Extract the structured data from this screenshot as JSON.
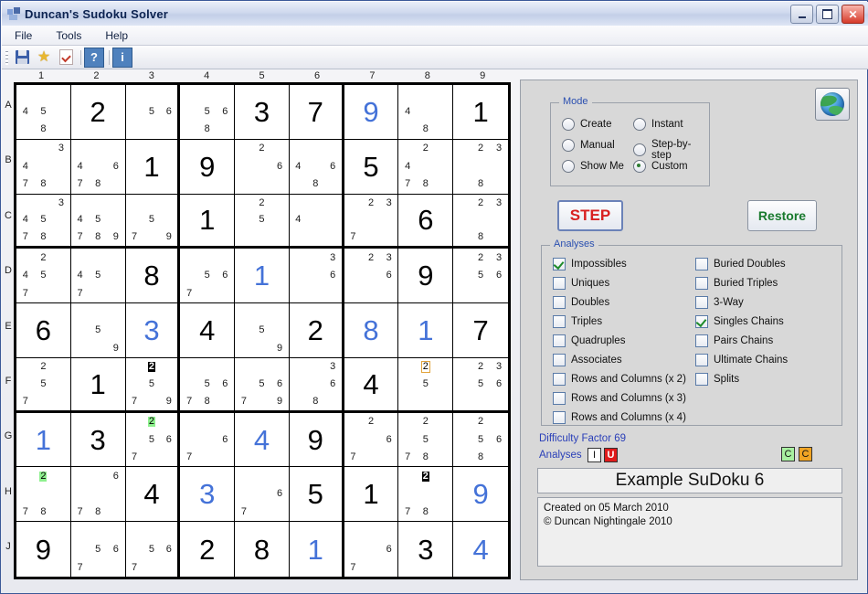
{
  "window": {
    "title": "Duncan's Sudoku Solver",
    "icon": "app-icon",
    "minimize_label": "Minimize",
    "maximize_label": "Maximize",
    "close_label": "✕"
  },
  "menu": {
    "items": [
      "File",
      "Tools",
      "Help"
    ]
  },
  "toolbar": {
    "items": [
      {
        "name": "save-icon",
        "label": ""
      },
      {
        "name": "star-icon",
        "label": ""
      },
      {
        "name": "check-document-icon",
        "label": ""
      },
      {
        "name": "help-button",
        "label": "?"
      },
      {
        "name": "info-button",
        "label": "i"
      }
    ]
  },
  "grid": {
    "column_labels": [
      "1",
      "2",
      "3",
      "4",
      "5",
      "6",
      "7",
      "8",
      "9"
    ],
    "row_labels": [
      "A",
      "B",
      "C",
      "D",
      "E",
      "F",
      "G",
      "H",
      "J"
    ],
    "cells": [
      [
        {
          "c": [
            null,
            null,
            null,
            "4",
            "5",
            null,
            null,
            "8",
            null
          ]
        },
        {
          "v": "2",
          "s": "given"
        },
        {
          "c": [
            null,
            null,
            null,
            null,
            "5",
            "6",
            null,
            null,
            null
          ]
        },
        {
          "c": [
            null,
            null,
            null,
            null,
            "5",
            "6",
            null,
            "8",
            null
          ]
        },
        {
          "v": "3",
          "s": "given"
        },
        {
          "v": "7",
          "s": "given"
        },
        {
          "v": "9",
          "s": "solved"
        },
        {
          "c": [
            null,
            null,
            null,
            "4",
            null,
            null,
            null,
            "8",
            null
          ]
        },
        {
          "v": "1",
          "s": "given"
        }
      ],
      [
        {
          "c": [
            null,
            null,
            "3",
            "4",
            null,
            null,
            "7",
            "8",
            null
          ]
        },
        {
          "c": [
            null,
            null,
            null,
            "4",
            null,
            "6",
            "7",
            "8",
            null
          ]
        },
        {
          "v": "1",
          "s": "given"
        },
        {
          "v": "9",
          "s": "given"
        },
        {
          "c": [
            null,
            "2",
            null,
            null,
            null,
            "6",
            null,
            null,
            null
          ]
        },
        {
          "c": [
            null,
            null,
            null,
            "4",
            null,
            "6",
            null,
            "8",
            null
          ]
        },
        {
          "v": "5",
          "s": "given"
        },
        {
          "c": [
            null,
            "2",
            null,
            "4",
            null,
            null,
            "7",
            "8",
            null
          ]
        },
        {
          "c": [
            null,
            "2",
            "3",
            null,
            null,
            null,
            null,
            "8",
            null
          ]
        }
      ],
      [
        {
          "c": [
            null,
            null,
            "3",
            "4",
            "5",
            null,
            "7",
            "8",
            null
          ]
        },
        {
          "c": [
            null,
            null,
            null,
            "4",
            "5",
            null,
            "7",
            "8",
            "9"
          ]
        },
        {
          "c": [
            null,
            null,
            null,
            null,
            "5",
            null,
            "7",
            null,
            "9"
          ]
        },
        {
          "v": "1",
          "s": "given"
        },
        {
          "c": [
            null,
            "2",
            null,
            null,
            "5",
            null,
            null,
            null,
            null
          ]
        },
        {
          "c": [
            null,
            null,
            null,
            "4",
            null,
            null,
            null,
            null,
            null
          ]
        },
        {
          "c": [
            null,
            "2",
            "3",
            null,
            null,
            null,
            "7",
            null,
            null
          ]
        },
        {
          "v": "6",
          "s": "given"
        },
        {
          "c": [
            null,
            "2",
            "3",
            null,
            null,
            null,
            null,
            "8",
            null
          ]
        }
      ],
      [
        {
          "c": [
            null,
            "2",
            null,
            "4",
            "5",
            null,
            "7",
            null,
            null
          ]
        },
        {
          "c": [
            null,
            null,
            null,
            "4",
            "5",
            null,
            "7",
            null,
            null
          ]
        },
        {
          "v": "8",
          "s": "given"
        },
        {
          "c": [
            null,
            null,
            null,
            null,
            "5",
            "6",
            "7",
            null,
            null
          ]
        },
        {
          "v": "1",
          "s": "solved"
        },
        {
          "c": [
            null,
            null,
            "3",
            null,
            null,
            "6",
            null,
            null,
            null
          ]
        },
        {
          "c": [
            null,
            "2",
            "3",
            null,
            null,
            "6",
            null,
            null,
            null
          ]
        },
        {
          "v": "9",
          "s": "given"
        },
        {
          "c": [
            null,
            "2",
            "3",
            null,
            "5",
            "6",
            null,
            null,
            null
          ]
        }
      ],
      [
        {
          "v": "6",
          "s": "given"
        },
        {
          "c": [
            null,
            null,
            null,
            null,
            "5",
            null,
            null,
            null,
            "9"
          ]
        },
        {
          "v": "3",
          "s": "solved"
        },
        {
          "v": "4",
          "s": "given"
        },
        {
          "c": [
            null,
            null,
            null,
            null,
            "5",
            null,
            null,
            null,
            "9"
          ]
        },
        {
          "v": "2",
          "s": "given"
        },
        {
          "v": "8",
          "s": "solved"
        },
        {
          "v": "1",
          "s": "solved"
        },
        {
          "v": "7",
          "s": "given"
        }
      ],
      [
        {
          "c": [
            null,
            "2",
            null,
            null,
            "5",
            null,
            "7",
            null,
            null
          ]
        },
        {
          "v": "1",
          "s": "given"
        },
        {
          "c": [
            null,
            "2",
            null,
            null,
            "5",
            null,
            "7",
            null,
            "9"
          ],
          "h": {
            "2": "black"
          }
        },
        {
          "c": [
            null,
            null,
            null,
            null,
            "5",
            "6",
            "7",
            "8",
            null
          ]
        },
        {
          "c": [
            null,
            null,
            null,
            null,
            "5",
            "6",
            "7",
            null,
            "9"
          ]
        },
        {
          "c": [
            null,
            null,
            "3",
            null,
            null,
            "6",
            null,
            "8",
            null
          ]
        },
        {
          "v": "4",
          "s": "given"
        },
        {
          "c": [
            null,
            "2",
            null,
            null,
            "5",
            null,
            null,
            null,
            null
          ],
          "h": {
            "2": "orange"
          }
        },
        {
          "c": [
            null,
            "2",
            "3",
            null,
            "5",
            "6",
            null,
            null,
            null
          ]
        }
      ],
      [
        {
          "v": "1",
          "s": "solved"
        },
        {
          "v": "3",
          "s": "given"
        },
        {
          "c": [
            null,
            "2",
            null,
            null,
            "5",
            "6",
            "7",
            null,
            null
          ],
          "h": {
            "2": "green"
          }
        },
        {
          "c": [
            null,
            null,
            null,
            null,
            null,
            "6",
            "7",
            null,
            null
          ]
        },
        {
          "v": "4",
          "s": "solved"
        },
        {
          "v": "9",
          "s": "given"
        },
        {
          "c": [
            null,
            "2",
            null,
            null,
            null,
            "6",
            "7",
            null,
            null
          ]
        },
        {
          "c": [
            null,
            "2",
            null,
            null,
            "5",
            null,
            "7",
            "8",
            null
          ]
        },
        {
          "c": [
            null,
            "2",
            null,
            null,
            "5",
            "6",
            null,
            "8",
            null
          ]
        }
      ],
      [
        {
          "c": [
            null,
            "2",
            null,
            null,
            null,
            null,
            "7",
            "8",
            null
          ],
          "h": {
            "2": "green"
          }
        },
        {
          "c": [
            null,
            null,
            "6",
            null,
            null,
            null,
            "7",
            "8",
            null
          ]
        },
        {
          "v": "4",
          "s": "given"
        },
        {
          "v": "3",
          "s": "solved"
        },
        {
          "c": [
            null,
            null,
            null,
            null,
            null,
            "6",
            "7",
            null,
            null
          ]
        },
        {
          "v": "5",
          "s": "given"
        },
        {
          "v": "1",
          "s": "given"
        },
        {
          "c": [
            null,
            "2",
            null,
            null,
            null,
            null,
            "7",
            "8",
            null
          ],
          "h": {
            "2": "black"
          }
        },
        {
          "v": "9",
          "s": "solved"
        }
      ],
      [
        {
          "v": "9",
          "s": "given"
        },
        {
          "c": [
            null,
            null,
            null,
            null,
            "5",
            "6",
            "7",
            null,
            null
          ]
        },
        {
          "c": [
            null,
            null,
            null,
            null,
            "5",
            "6",
            "7",
            null,
            null
          ]
        },
        {
          "v": "2",
          "s": "given"
        },
        {
          "v": "8",
          "s": "given"
        },
        {
          "v": "1",
          "s": "solved"
        },
        {
          "c": [
            null,
            null,
            null,
            null,
            null,
            "6",
            "7",
            null,
            null
          ]
        },
        {
          "v": "3",
          "s": "given"
        },
        {
          "v": "4",
          "s": "solved"
        }
      ]
    ]
  },
  "panel": {
    "globe_icon": "globe-icon",
    "mode": {
      "legend": "Mode",
      "options": [
        {
          "label": "Create",
          "selected": false
        },
        {
          "label": "Instant",
          "selected": false
        },
        {
          "label": "Manual",
          "selected": false
        },
        {
          "label": "Step-by-step",
          "selected": false
        },
        {
          "label": "Show Me",
          "selected": false
        },
        {
          "label": "Custom",
          "selected": true
        }
      ]
    },
    "step_button": "STEP",
    "restore_button": "Restore",
    "analyses": {
      "legend": "Analyses",
      "left": [
        {
          "label": "Impossibles",
          "checked": true
        },
        {
          "label": "Uniques",
          "checked": false
        },
        {
          "label": "Doubles",
          "checked": false
        },
        {
          "label": "Triples",
          "checked": false
        },
        {
          "label": "Quadruples",
          "checked": false
        },
        {
          "label": "Associates",
          "checked": false
        },
        {
          "label": "Rows and Columns (x 2)",
          "checked": false
        },
        {
          "label": "Rows and Columns (x 3)",
          "checked": false
        },
        {
          "label": "Rows and Columns (x 4)",
          "checked": false
        }
      ],
      "right": [
        {
          "label": "Buried Doubles",
          "checked": false
        },
        {
          "label": "Buried Triples",
          "checked": false
        },
        {
          "label": "3-Way",
          "checked": false
        },
        {
          "label": "Singles Chains",
          "checked": true
        },
        {
          "label": "Pairs Chains",
          "checked": false
        },
        {
          "label": "Ultimate Chains",
          "checked": false
        },
        {
          "label": "Splits",
          "checked": false
        }
      ]
    },
    "difficulty": "Difficulty Factor 69",
    "analyses_label": "Analyses",
    "badges": [
      {
        "name": "impossibles-badge",
        "label": "I",
        "color": "#ffffff"
      },
      {
        "name": "uniques-badge",
        "label": "U",
        "color": "#e01b1b"
      },
      {
        "name": "chain-badge-green",
        "label": "C",
        "color": "#a8f0a0"
      },
      {
        "name": "chain-badge-orange",
        "label": "C",
        "color": "#f0a424"
      }
    ],
    "puzzle_name": "Example SuDoku 6",
    "notes_line1": "Created on 05 March 2010",
    "notes_line2": "© Duncan Nightingale 2010"
  }
}
